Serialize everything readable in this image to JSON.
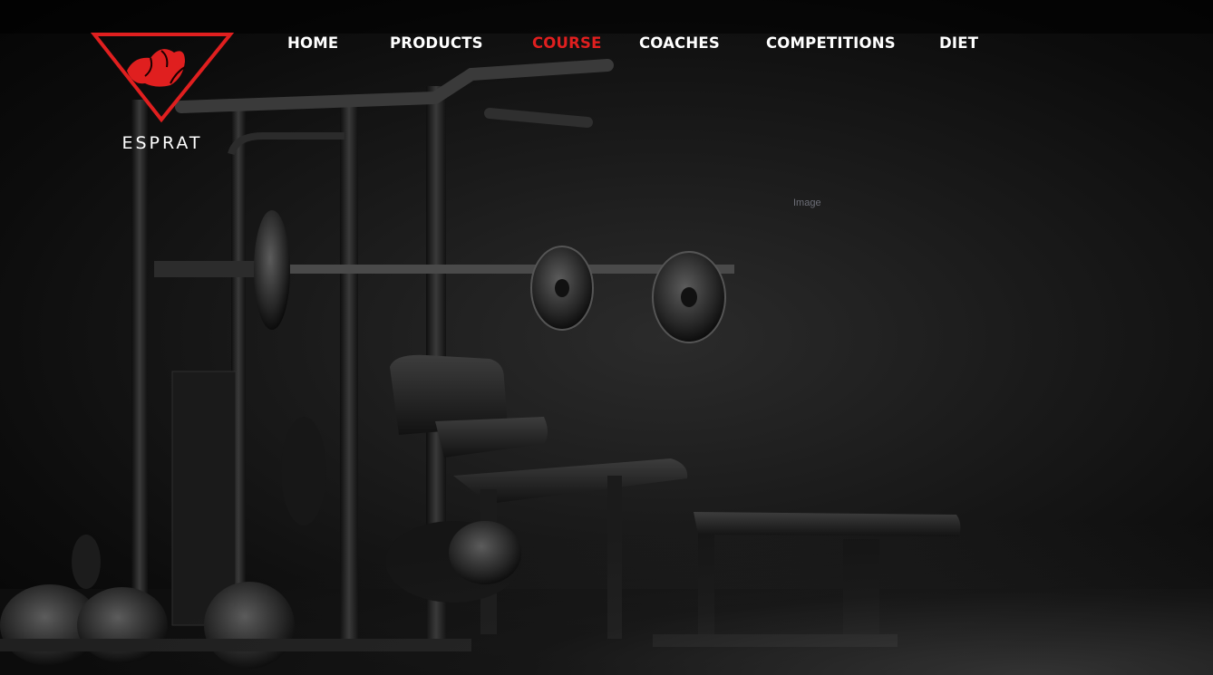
{
  "brand": {
    "name": "ESPRAT",
    "logo_icon": "flexed-arm-triangle-icon",
    "accent_color": "#e01f1f"
  },
  "nav": {
    "items": [
      {
        "label": "HOME",
        "active": false
      },
      {
        "label": "PRODUCTS",
        "active": false
      },
      {
        "label": "COURSE",
        "active": true
      },
      {
        "label": "COACHES",
        "active": false
      },
      {
        "label": "COMPETITIONS",
        "active": false
      },
      {
        "label": "DIET",
        "active": false
      }
    ]
  },
  "hero": {
    "image_caption": "Image"
  }
}
